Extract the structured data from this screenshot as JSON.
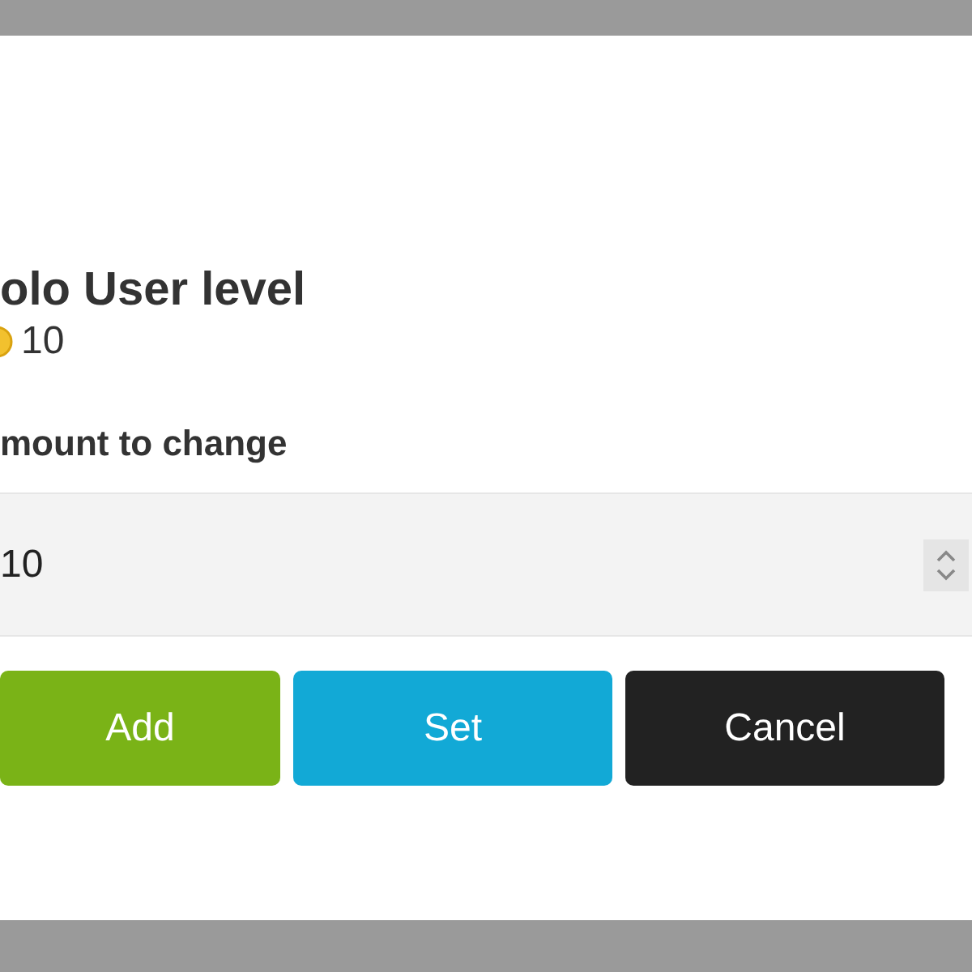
{
  "dialog": {
    "title": "olo User level",
    "current_value": "10",
    "field_label": "mount to change",
    "amount": {
      "value": "10"
    },
    "buttons": [
      {
        "kind": "add",
        "label": "Add"
      },
      {
        "kind": "set",
        "label": "Set"
      },
      {
        "kind": "cancel",
        "label": "Cancel"
      }
    ]
  }
}
